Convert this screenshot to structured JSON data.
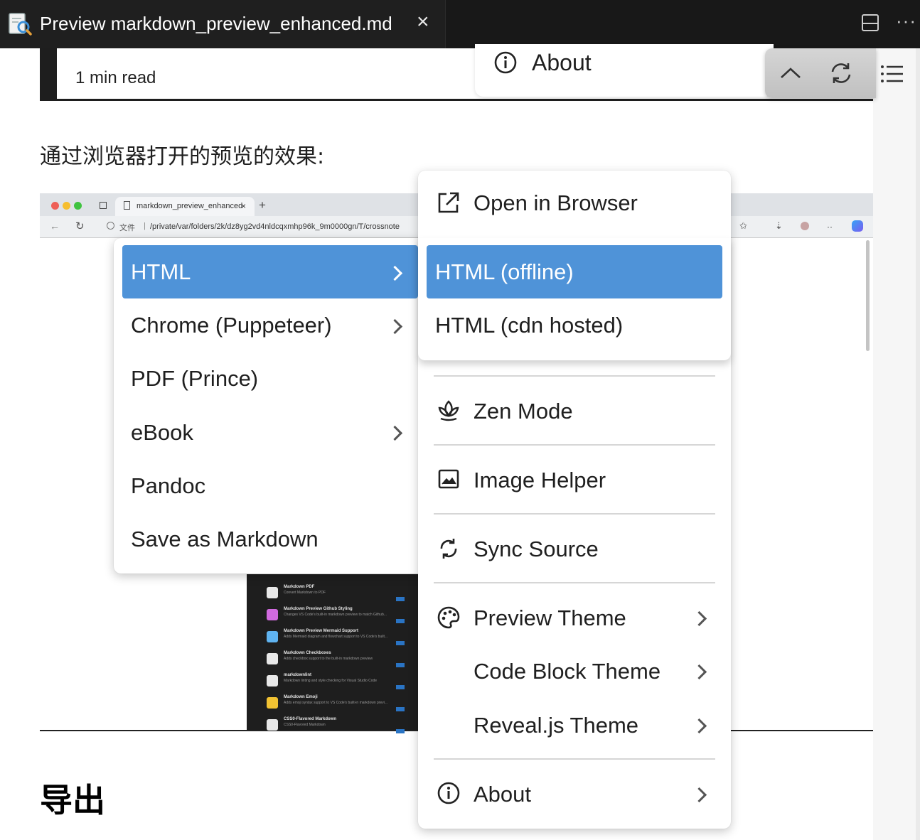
{
  "tab": {
    "title": "Preview markdown_preview_enhanced.md",
    "close": "×"
  },
  "header": {
    "read_time": "1 min read"
  },
  "about_popover": {
    "label": "About"
  },
  "content": {
    "paragraph": "通过浏览器打开的预览的效果:",
    "heading": "导出"
  },
  "embedded_browser": {
    "tab_label": "markdown_preview_enhanced",
    "tab_close": "×",
    "new_tab": "+",
    "url_prefix": "文件",
    "url": "/private/var/folders/2k/dz8yg2vd4nldcqxmhp96k_9m0000gn/T/crossnote",
    "extensions": [
      {
        "title": "Markdown PDF",
        "desc": "Convert Markdown to PDF"
      },
      {
        "title": "Markdown Preview Github Styling",
        "desc": "Changes VS Code's built-in markdown preview to match Github..."
      },
      {
        "title": "Markdown Preview Mermaid Support",
        "desc": "Adds Mermaid diagram and flowchart support to VS Code's built..."
      },
      {
        "title": "Markdown Checkboxes",
        "desc": "Adds checkbox support to the built-in markdown preview"
      },
      {
        "title": "markdownlint",
        "desc": "Markdown linting and style checking for Visual Studio Code"
      },
      {
        "title": "Markdown Emoji",
        "desc": "Adds emoji syntax support to VS Code's built-in markdown previ..."
      },
      {
        "title": "CSS0-Flavored Markdown",
        "desc": "CSS0-Flavored Markdown"
      }
    ]
  },
  "export_menu": {
    "items": [
      {
        "label": "HTML",
        "has_submenu": true,
        "selected": true
      },
      {
        "label": "Chrome (Puppeteer)",
        "has_submenu": true
      },
      {
        "label": "PDF (Prince)",
        "has_submenu": false
      },
      {
        "label": "eBook",
        "has_submenu": true
      },
      {
        "label": "Pandoc",
        "has_submenu": false
      },
      {
        "label": "Save as Markdown",
        "has_submenu": false
      }
    ]
  },
  "main_menu": {
    "open_in_browser": "Open in Browser",
    "zen_mode": "Zen Mode",
    "image_helper": "Image Helper",
    "sync_source": "Sync Source",
    "preview_theme": "Preview Theme",
    "code_block_theme": "Code Block Theme",
    "revealjs_theme": "Reveal.js Theme",
    "about": "About"
  },
  "html_submenu": {
    "items": [
      {
        "label": "HTML (offline)",
        "selected": true
      },
      {
        "label": "HTML (cdn hosted)",
        "selected": false
      }
    ]
  },
  "colors": {
    "selection": "#4f93d8",
    "tabbar": "#181818"
  }
}
